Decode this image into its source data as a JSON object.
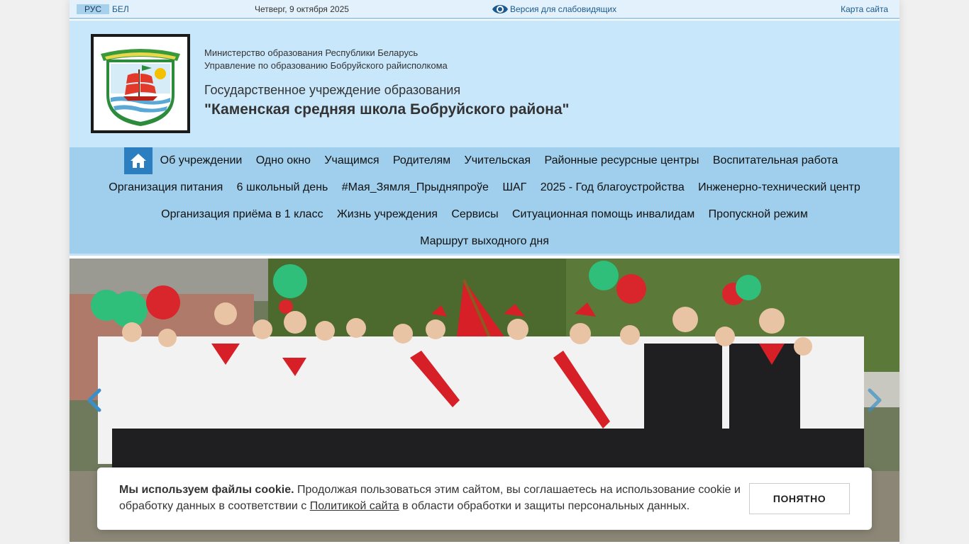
{
  "topbar": {
    "lang_ru": "РУС",
    "lang_be": "БЕЛ",
    "date": "Четверг, 9 октября 2025",
    "low_vision": "Версия для слабовидящих",
    "sitemap": "Карта сайта"
  },
  "header": {
    "ministry": "Министерство образования Республики Беларусь",
    "department": "Управление по образованию Бобруйского райисполкома",
    "institution_type": "Государственное учреждение образования",
    "school_name": "\"Каменская средняя школа Бобруйского района\""
  },
  "nav": {
    "row1": [
      "Об учреждении",
      "Одно окно",
      "Учащимся",
      "Родителям",
      "Учительская",
      "Районные ресурсные центры",
      "Воспитательная работа"
    ],
    "row2": [
      "Организация питания",
      "6 школьный день",
      "#Мая_Зямля_Прыдняпроўе",
      "ШАГ",
      "2025 - Год благоустройства",
      "Инженерно-технический центр"
    ],
    "row3": [
      "Организация приёма в 1 класс",
      "Жизнь учреждения",
      "Сервисы",
      "Ситуационная помощь инвалидам",
      "Пропускной режим"
    ],
    "row4": [
      "Маршрут выходного дня"
    ]
  },
  "cookie": {
    "bold": "Мы используем файлы cookie.",
    "text_before_link": " Продолжая пользоваться этим сайтом, вы соглашаетесь на использование cookie и обработку данных в соответствии с ",
    "link": "Политикой сайта",
    "text_after_link": " в области обработки и защиты персональных данных.",
    "button": "ПОНЯТНО"
  },
  "colors": {
    "topbar_bg": "#e2f1fb",
    "header_bg": "#c9e7fb",
    "nav_bg": "#9fcfec",
    "home_button": "#2b7fc1",
    "link": "#1b5a8e"
  },
  "icons": [
    "eye-icon",
    "home-icon",
    "chevron-left-icon",
    "chevron-right-icon"
  ]
}
